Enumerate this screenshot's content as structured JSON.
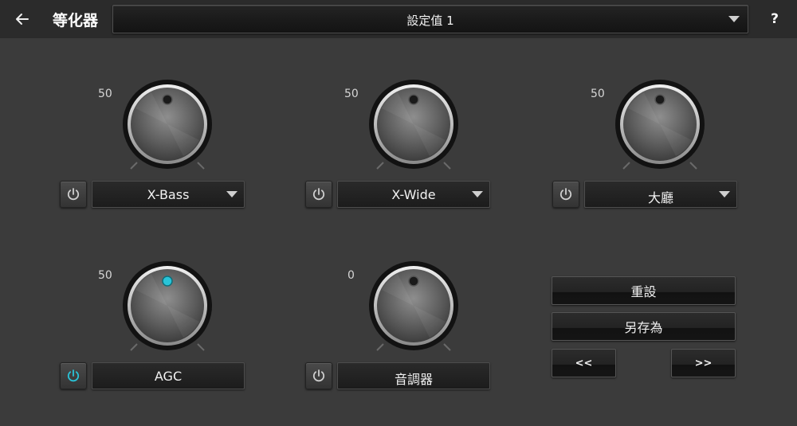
{
  "header": {
    "title": "等化器",
    "preset": "設定值 1",
    "help": "?"
  },
  "effects": [
    {
      "id": "xbass",
      "value": "50",
      "name": "X-Bass",
      "has_dropdown": true,
      "enabled": false
    },
    {
      "id": "xwide",
      "value": "50",
      "name": "X-Wide",
      "has_dropdown": true,
      "enabled": false
    },
    {
      "id": "hall",
      "value": "50",
      "name": "大廳",
      "has_dropdown": true,
      "enabled": false
    },
    {
      "id": "agc",
      "value": "50",
      "name": "AGC",
      "has_dropdown": false,
      "enabled": true
    },
    {
      "id": "tone",
      "value": "0",
      "name": "音調器",
      "has_dropdown": false,
      "enabled": false
    }
  ],
  "actions": {
    "reset": "重設",
    "save_as": "另存為",
    "prev": "<<",
    "next": ">>"
  },
  "colors": {
    "background": "#3b3b3b",
    "topbar": "#2b2b2b",
    "accent_on": "#29c4d8",
    "icon_off": "#cfcfcf"
  }
}
